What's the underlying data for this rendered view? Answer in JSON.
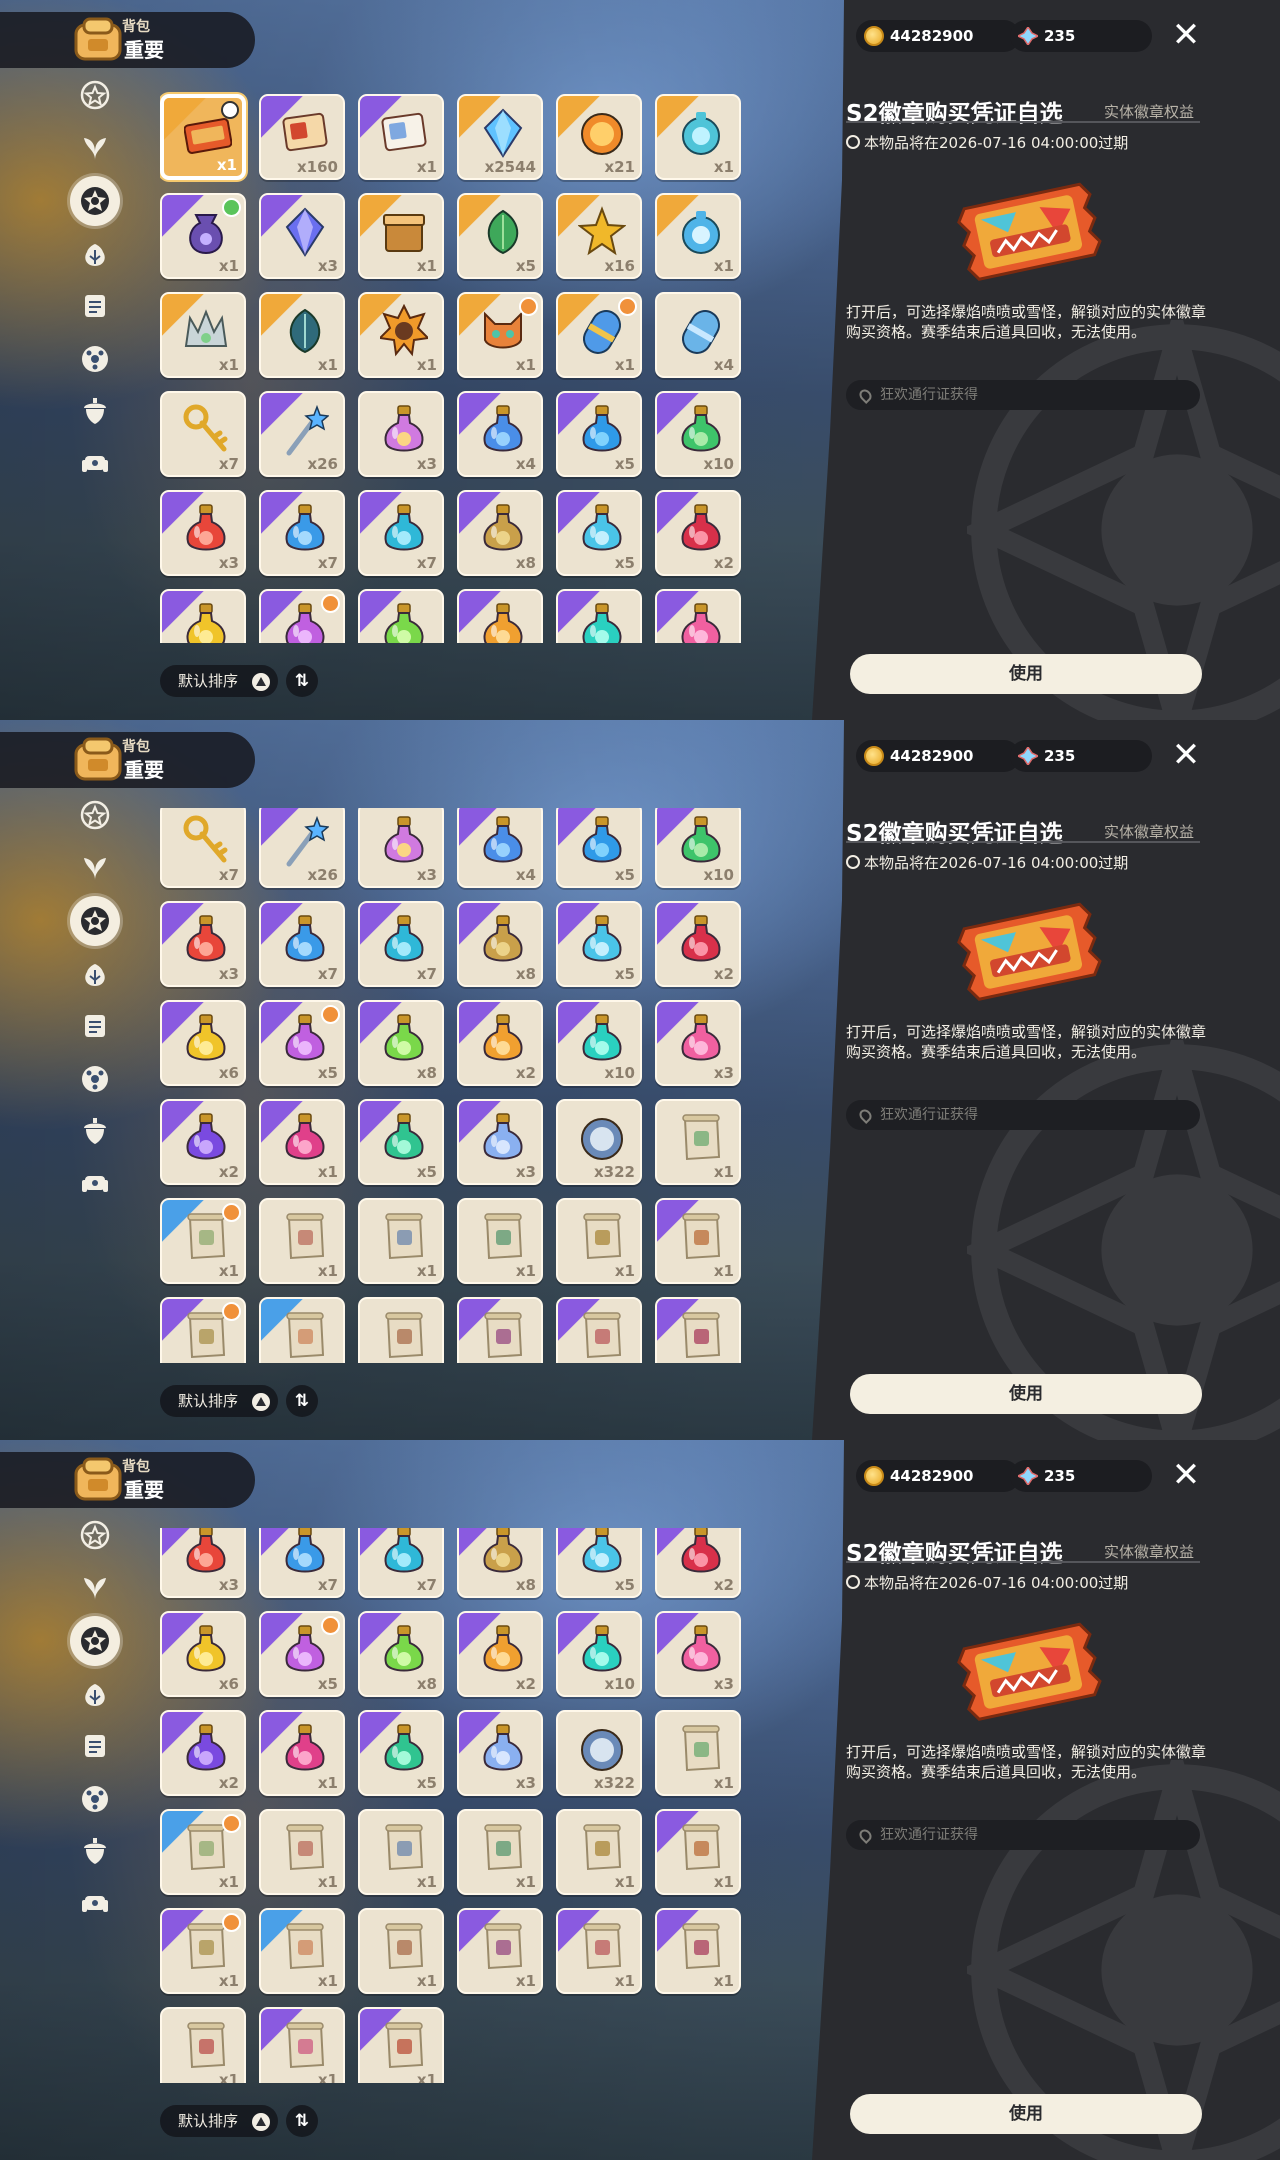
{
  "header": {
    "bag_label": "背包",
    "tab_label": "重要"
  },
  "currency": {
    "coins": "44282900",
    "gems": "235"
  },
  "nav": [
    "star-tab",
    "leaf-tab",
    "special-tab",
    "flower-tab",
    "scroll-tab",
    "ball-tab",
    "acorn-tab",
    "furniture-tab"
  ],
  "detail": {
    "title": "S2徽章购买凭证自选",
    "category": "实体徽章权益",
    "expire": "本物品将在2026-07-16 04:00:00过期",
    "description": "打开后，可选择爆焰喷喷或雪怪，解锁对应的实体徽章购买资格。赛季结束后道具回收，无法使用。",
    "source": "狂欢通行证获得",
    "use_button": "使用"
  },
  "sort": {
    "label": "默认排序",
    "toggle": "⇅"
  },
  "colors": {
    "accent": "#f0b65b",
    "panel_dark": "#2a2b2f",
    "orange_rarity": "#f0a93a",
    "purple_rarity": "#8a5ae0",
    "blue_rarity": "#4aa0e8",
    "new_badge": "#f0913a"
  },
  "items": [
    {
      "name": "badge-voucher",
      "count": "x1",
      "art": "ticket",
      "c1": "#e65a2a",
      "c2": "#f0b65b",
      "rarity": "orange",
      "selected": true
    },
    {
      "name": "photo-card",
      "count": "x160",
      "art": "card",
      "c1": "#d2472e",
      "c2": "#f5d8a8",
      "rarity": "purple"
    },
    {
      "name": "letter",
      "count": "x1",
      "art": "card",
      "c1": "#7fa8e0",
      "c2": "#f7f2e8",
      "rarity": "purple"
    },
    {
      "name": "crystal-shard",
      "count": "x2544",
      "art": "gem",
      "c1": "#5fc2ff",
      "c2": "#b7e9ff",
      "rarity": "orange"
    },
    {
      "name": "flame-coin",
      "count": "x21",
      "art": "coin",
      "c1": "#f08a2a",
      "c2": "#ffcf6a",
      "rarity": "orange"
    },
    {
      "name": "spirit-bottle",
      "count": "x1",
      "art": "bottle",
      "c1": "#4fc4d8",
      "c2": "#bff3ff",
      "rarity": "orange"
    },
    {
      "name": "star-pouch",
      "count": "x1",
      "art": "bag",
      "c1": "#6a4fb0",
      "c2": "#c4b0ff",
      "rarity": "purple",
      "badge": "green"
    },
    {
      "name": "dream-crystal",
      "count": "x3",
      "art": "gem",
      "c1": "#6a6ff0",
      "c2": "#d0c8ff",
      "rarity": "purple"
    },
    {
      "name": "gift-box",
      "count": "x1",
      "art": "box",
      "c1": "#c9893a",
      "c2": "#f3c27a",
      "rarity": "orange"
    },
    {
      "name": "green-hat",
      "count": "x5",
      "art": "leaf",
      "c1": "#3ea85a",
      "c2": "#9de09b",
      "rarity": "orange"
    },
    {
      "name": "gold-star",
      "count": "x16",
      "art": "star",
      "c1": "#f0b82a",
      "c2": "#ffe57a",
      "rarity": "orange"
    },
    {
      "name": "water-orb",
      "count": "x1",
      "art": "orb",
      "c1": "#4fb4e8",
      "c2": "#d8f4ff",
      "rarity": "orange"
    },
    {
      "name": "crown",
      "count": "x1",
      "art": "crown",
      "c1": "#c9d5d8",
      "c2": "#7fd08a",
      "rarity": "orange"
    },
    {
      "name": "shadow-feather",
      "count": "x1",
      "art": "leaf",
      "c1": "#2f6a7a",
      "c2": "#a0d8d0",
      "rarity": "orange"
    },
    {
      "name": "sun-emblem",
      "count": "x1",
      "art": "sun",
      "c1": "#f09a2a",
      "c2": "#6a3a20",
      "rarity": "orange"
    },
    {
      "name": "fox-mask",
      "count": "x1",
      "art": "mask",
      "c1": "#e8823a",
      "c2": "#4fc4a8",
      "rarity": "orange",
      "badge": "new"
    },
    {
      "name": "capsule-gold",
      "count": "x1",
      "art": "capsule",
      "c1": "#4f9ae8",
      "c2": "#f0c44a",
      "rarity": "orange",
      "badge": "new"
    },
    {
      "name": "capsule-blue",
      "count": "x4",
      "art": "capsule",
      "c1": "#6ab4e8",
      "c2": "#c8e8ff",
      "rarity": "none"
    },
    {
      "name": "golden-key",
      "count": "x7",
      "art": "key",
      "c1": "#e0a82a",
      "c2": "#ffe07a",
      "rarity": "none"
    },
    {
      "name": "star-wand",
      "count": "x26",
      "art": "wand",
      "c1": "#8aa0b8",
      "c2": "#5ab4ff",
      "rarity": "purple"
    },
    {
      "name": "rainbow-potion",
      "count": "x3",
      "art": "potion",
      "c1": "#d07ae0",
      "c2": "#ffe07a",
      "rarity": "none"
    },
    {
      "name": "blue-vial",
      "count": "x4",
      "art": "potion",
      "c1": "#4a8ee8",
      "c2": "#a0d8ff",
      "rarity": "purple"
    },
    {
      "name": "potion-cyan-star",
      "count": "x5",
      "art": "potion",
      "c1": "#2f9ae8",
      "c2": "#8ad8ff",
      "rarity": "purple"
    },
    {
      "name": "potion-green",
      "count": "x10",
      "art": "potion",
      "c1": "#3ec46a",
      "c2": "#b4f0b0",
      "rarity": "purple"
    },
    {
      "name": "potion-red",
      "count": "x3",
      "art": "potion",
      "c1": "#e8463a",
      "c2": "#ffb0a0",
      "rarity": "purple"
    },
    {
      "name": "potion-sky",
      "count": "x7",
      "art": "potion",
      "c1": "#3a9ae8",
      "c2": "#b0e0ff",
      "rarity": "purple"
    },
    {
      "name": "potion-aqua",
      "count": "x7",
      "art": "potion",
      "c1": "#2fb8d8",
      "c2": "#b0f0ff",
      "rarity": "purple"
    },
    {
      "name": "potion-earth",
      "count": "x8",
      "art": "potion",
      "c1": "#c9a04a",
      "c2": "#f0d890",
      "rarity": "purple"
    },
    {
      "name": "potion-ice",
      "count": "x5",
      "art": "potion",
      "c1": "#4ac4e8",
      "c2": "#d0f4ff",
      "rarity": "purple"
    },
    {
      "name": "potion-crimson",
      "count": "x2",
      "art": "potion",
      "c1": "#d8304a",
      "c2": "#ffa0b0",
      "rarity": "purple"
    },
    {
      "name": "potion-yellow",
      "count": "x6",
      "art": "potion",
      "c1": "#f0c42a",
      "c2": "#fff0a0",
      "rarity": "purple"
    },
    {
      "name": "potion-violet",
      "count": "x5",
      "art": "potion",
      "c1": "#c060e0",
      "c2": "#f0c0ff",
      "rarity": "purple",
      "badge": "new"
    },
    {
      "name": "potion-lime",
      "count": "x8",
      "art": "potion",
      "c1": "#7ad84a",
      "c2": "#d8ffb0",
      "rarity": "purple"
    },
    {
      "name": "potion-orange",
      "count": "x2",
      "art": "potion",
      "c1": "#f0a030",
      "c2": "#ffe0a0",
      "rarity": "purple"
    },
    {
      "name": "potion-teal",
      "count": "x10",
      "art": "potion",
      "c1": "#2ad0c0",
      "c2": "#b0fff0",
      "rarity": "purple"
    },
    {
      "name": "potion-pink",
      "count": "x3",
      "art": "potion",
      "c1": "#f060a0",
      "c2": "#ffc0e0",
      "rarity": "purple"
    },
    {
      "name": "potion-purple",
      "count": "x2",
      "art": "potion",
      "c1": "#7a4ae0",
      "c2": "#d0b0ff",
      "rarity": "purple"
    },
    {
      "name": "potion-magenta",
      "count": "x1",
      "art": "potion",
      "c1": "#e0408a",
      "c2": "#ffb0d0",
      "rarity": "purple"
    },
    {
      "name": "potion-mint",
      "count": "x5",
      "art": "potion",
      "c1": "#30c490",
      "c2": "#b0ffe0",
      "rarity": "purple"
    },
    {
      "name": "potion-swirl",
      "count": "x3",
      "art": "potion",
      "c1": "#8ab0f0",
      "c2": "#e0ecff",
      "rarity": "purple"
    },
    {
      "name": "robot-coin",
      "count": "x322",
      "art": "token",
      "c1": "#6a8ab8",
      "c2": "#d8e4f0",
      "rarity": "none"
    },
    {
      "name": "scroll-green",
      "count": "x1",
      "art": "scroll",
      "c1": "#7ab07a",
      "c2": "#e8dcc4",
      "rarity": "none"
    },
    {
      "name": "scroll-a",
      "count": "x1",
      "art": "scroll",
      "c1": "#9ab07a",
      "c2": "#e8dcc4",
      "rarity": "blue",
      "badge": "new"
    },
    {
      "name": "scroll-b",
      "count": "x1",
      "art": "scroll",
      "c1": "#c07a6a",
      "c2": "#e8dcc4",
      "rarity": "none"
    },
    {
      "name": "scroll-c",
      "count": "x1",
      "art": "scroll",
      "c1": "#7a90b0",
      "c2": "#e8dcc4",
      "rarity": "none"
    },
    {
      "name": "scroll-d",
      "count": "x1",
      "art": "scroll",
      "c1": "#6aa07a",
      "c2": "#e8dcc4",
      "rarity": "none"
    },
    {
      "name": "scroll-e",
      "count": "x1",
      "art": "scroll",
      "c1": "#b0904a",
      "c2": "#e8dcc4",
      "rarity": "none"
    },
    {
      "name": "scroll-f",
      "count": "x1",
      "art": "scroll",
      "c1": "#c07a4a",
      "c2": "#e8dcc4",
      "rarity": "purple"
    },
    {
      "name": "scroll-g",
      "count": "x1",
      "art": "scroll",
      "c1": "#b09a5a",
      "c2": "#e8dcc4",
      "rarity": "purple",
      "badge": "new"
    },
    {
      "name": "scroll-h",
      "count": "x1",
      "art": "scroll",
      "c1": "#d0906a",
      "c2": "#e8dcc4",
      "rarity": "blue"
    },
    {
      "name": "scroll-i",
      "count": "x1",
      "art": "scroll",
      "c1": "#b07a5a",
      "c2": "#e8dcc4",
      "rarity": "none"
    },
    {
      "name": "scroll-j",
      "count": "x1",
      "art": "scroll",
      "c1": "#a05a8a",
      "c2": "#e8dcc4",
      "rarity": "purple"
    },
    {
      "name": "scroll-k",
      "count": "x1",
      "art": "scroll",
      "c1": "#c06a6a",
      "c2": "#e8dcc4",
      "rarity": "purple"
    },
    {
      "name": "scroll-l",
      "count": "x1",
      "art": "scroll",
      "c1": "#b0506a",
      "c2": "#e8dcc4",
      "rarity": "purple"
    },
    {
      "name": "scroll-m",
      "count": "x1",
      "art": "scroll",
      "c1": "#c0605a",
      "c2": "#e8dcc4",
      "rarity": "none"
    },
    {
      "name": "scroll-n",
      "count": "x1",
      "art": "scroll",
      "c1": "#d06a8a",
      "c2": "#e8dcc4",
      "rarity": "purple"
    },
    {
      "name": "scroll-o",
      "count": "x1",
      "art": "scroll",
      "c1": "#c0604a",
      "c2": "#e8dcc4",
      "rarity": "purple"
    }
  ],
  "panels": [
    {
      "first_row": 0,
      "rows": 6
    },
    {
      "first_row": 3,
      "rows": 6
    },
    {
      "first_row": 4,
      "rows": 6
    }
  ]
}
